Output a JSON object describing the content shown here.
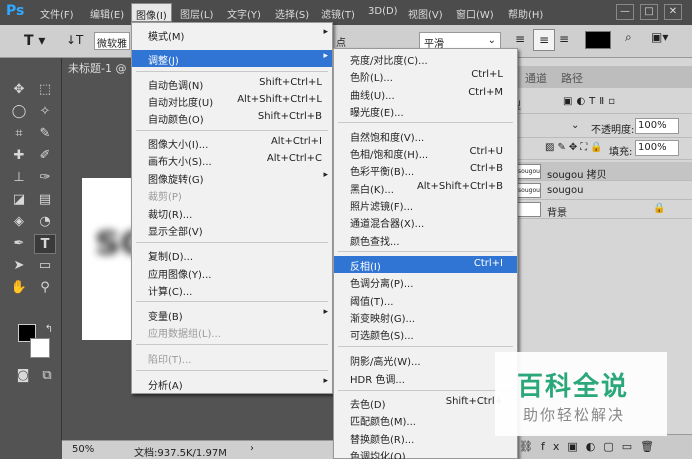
{
  "menubar": {
    "items": [
      "文件(F)",
      "编辑(E)",
      "图像(I)",
      "图层(L)",
      "文字(Y)",
      "选择(S)",
      "滤镜(T)",
      "3D(D)",
      "视图(V)",
      "窗口(W)",
      "帮助(H)"
    ],
    "logo": "Ps",
    "active_index": 2,
    "window_buttons": [
      "—",
      "□",
      "✕"
    ]
  },
  "options": {
    "font_family": "微软雅",
    "font_size": "点",
    "antialias": "平滑"
  },
  "document": {
    "tab_title": "未标题-1 @",
    "canvas_text": "so"
  },
  "status": {
    "zoom": "50%",
    "doc_size": "文档:937.5K/1.97M"
  },
  "panel": {
    "tabs": [
      "通道",
      "路径"
    ],
    "kind_label": "型",
    "opacity_label": "不透明度:",
    "opacity_value": "100%",
    "fill_label": "填充:",
    "fill_value": "100%",
    "layers": [
      {
        "name": "sougou 拷贝",
        "thumb": "sougou"
      },
      {
        "name": "sougou",
        "thumb": "sougou"
      },
      {
        "name": "背景",
        "thumb": ""
      }
    ]
  },
  "image_menu": {
    "items": [
      {
        "label": "模式(M)",
        "shortcut": "",
        "submenu": true,
        "disabled": false
      },
      {
        "label": "调整(J)",
        "shortcut": "",
        "submenu": true,
        "disabled": false,
        "highlight": true
      },
      {
        "label": "自动色调(N)",
        "shortcut": "Shift+Ctrl+L",
        "submenu": false,
        "disabled": false
      },
      {
        "label": "自动对比度(U)",
        "shortcut": "Alt+Shift+Ctrl+L",
        "submenu": false,
        "disabled": false
      },
      {
        "label": "自动颜色(O)",
        "shortcut": "Shift+Ctrl+B",
        "submenu": false,
        "disabled": false
      },
      {
        "label": "图像大小(I)...",
        "shortcut": "Alt+Ctrl+I",
        "submenu": false,
        "disabled": false
      },
      {
        "label": "画布大小(S)...",
        "shortcut": "Alt+Ctrl+C",
        "submenu": false,
        "disabled": false
      },
      {
        "label": "图像旋转(G)",
        "shortcut": "",
        "submenu": true,
        "disabled": false
      },
      {
        "label": "裁剪(P)",
        "shortcut": "",
        "submenu": false,
        "disabled": true
      },
      {
        "label": "裁切(R)...",
        "shortcut": "",
        "submenu": false,
        "disabled": false
      },
      {
        "label": "显示全部(V)",
        "shortcut": "",
        "submenu": false,
        "disabled": false
      },
      {
        "label": "复制(D)...",
        "shortcut": "",
        "submenu": false,
        "disabled": false
      },
      {
        "label": "应用图像(Y)...",
        "shortcut": "",
        "submenu": false,
        "disabled": false
      },
      {
        "label": "计算(C)...",
        "shortcut": "",
        "submenu": false,
        "disabled": false
      },
      {
        "label": "变量(B)",
        "shortcut": "",
        "submenu": true,
        "disabled": false
      },
      {
        "label": "应用数据组(L)...",
        "shortcut": "",
        "submenu": false,
        "disabled": true
      },
      {
        "label": "陷印(T)...",
        "shortcut": "",
        "submenu": false,
        "disabled": true
      },
      {
        "label": "分析(A)",
        "shortcut": "",
        "submenu": true,
        "disabled": false
      }
    ]
  },
  "adjust_menu": {
    "items": [
      {
        "label": "亮度/对比度(C)...",
        "shortcut": ""
      },
      {
        "label": "色阶(L)...",
        "shortcut": "Ctrl+L"
      },
      {
        "label": "曲线(U)...",
        "shortcut": "Ctrl+M"
      },
      {
        "label": "曝光度(E)...",
        "shortcut": ""
      },
      {
        "label": "自然饱和度(V)...",
        "shortcut": ""
      },
      {
        "label": "色相/饱和度(H)...",
        "shortcut": "Ctrl+U"
      },
      {
        "label": "色彩平衡(B)...",
        "shortcut": "Ctrl+B"
      },
      {
        "label": "黑白(K)...",
        "shortcut": "Alt+Shift+Ctrl+B"
      },
      {
        "label": "照片滤镜(F)...",
        "shortcut": ""
      },
      {
        "label": "通道混合器(X)...",
        "shortcut": ""
      },
      {
        "label": "颜色查找...",
        "shortcut": ""
      },
      {
        "label": "反相(I)",
        "shortcut": "Ctrl+I",
        "highlight": true
      },
      {
        "label": "色调分离(P)...",
        "shortcut": ""
      },
      {
        "label": "阈值(T)...",
        "shortcut": ""
      },
      {
        "label": "渐变映射(G)...",
        "shortcut": ""
      },
      {
        "label": "可选颜色(S)...",
        "shortcut": ""
      },
      {
        "label": "阴影/高光(W)...",
        "shortcut": ""
      },
      {
        "label": "HDR 色调...",
        "shortcut": ""
      },
      {
        "label": "去色(D)",
        "shortcut": "Shift+Ctrl+"
      },
      {
        "label": "匹配颜色(M)...",
        "shortcut": ""
      },
      {
        "label": "替换颜色(R)...",
        "shortcut": ""
      },
      {
        "label": "色调均化(Q)",
        "shortcut": ""
      }
    ]
  },
  "watermark": {
    "title": "百科全说",
    "subtitle": "助你轻松解决"
  }
}
